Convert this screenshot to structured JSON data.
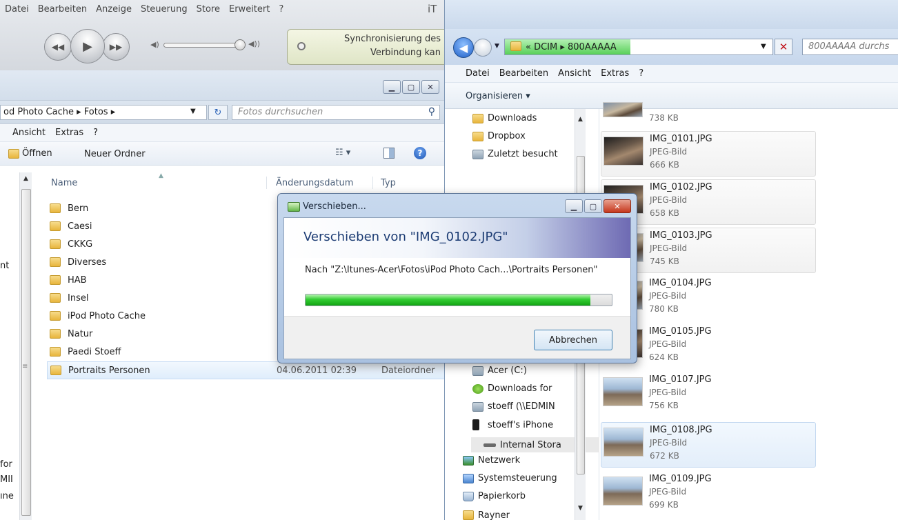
{
  "itunes": {
    "menu": [
      "Datei",
      "Bearbeiten",
      "Anzeige",
      "Steuerung",
      "Store",
      "Erweitert",
      "?"
    ],
    "title_fragment": "iT",
    "sync_line1": "Synchronisierung des",
    "sync_line2": "Verbindung kan"
  },
  "left_window": {
    "breadcrumb": "od Photo Cache ▸ Fotos ▸",
    "search_placeholder": "Fotos durchsuchen",
    "menu": [
      "Ansicht",
      "Extras",
      "?"
    ],
    "toolbar": {
      "open_label": "Öffnen",
      "new_folder_label": "Neuer Ordner"
    },
    "columns": {
      "name": "Name",
      "date": "Änderungsdatum",
      "type": "Typ"
    },
    "nav_fragments": [
      "nt",
      "for",
      "MII",
      "ıne"
    ],
    "folders": [
      {
        "name": "Bern"
      },
      {
        "name": "Caesi"
      },
      {
        "name": "CKKG"
      },
      {
        "name": "Diverses"
      },
      {
        "name": "HAB"
      },
      {
        "name": "Insel"
      },
      {
        "name": "iPod Photo Cache"
      },
      {
        "name": "Natur"
      },
      {
        "name": "Paedi Stoeff"
      },
      {
        "name": "Portraits Personen",
        "date": "04.06.2011 02:39",
        "type": "Dateiordner",
        "selected": true
      }
    ]
  },
  "right_window": {
    "address": "« DCIM ▸ 800AAAAA",
    "address_progress": 0.47,
    "search_placeholder": "800AAAAA durchs",
    "menu": [
      "Datei",
      "Bearbeiten",
      "Ansicht",
      "Extras",
      "?"
    ],
    "organize_label": "Organisieren ▾",
    "nav_items": {
      "downloads": "Downloads",
      "dropbox": "Dropbox",
      "recent": "Zuletzt besucht",
      "acer": "Acer (C:)",
      "downloads_for": "Downloads for",
      "stoeff_share": "stoeff (\\\\EDMIN",
      "stoeff_iphone": "stoeff's iPhone",
      "internal_storage": "Internal Stora",
      "network": "Netzwerk",
      "control_panel": "Systemsteuerung",
      "trash": "Papierkorb",
      "partial": "Rayner"
    },
    "top_tile_size": "738 KB",
    "files": [
      {
        "name": "IMG_0101.JPG",
        "type": "JPEG-Bild",
        "size": "666 KB"
      },
      {
        "name": "IMG_0102.JPG",
        "type": "JPEG-Bild",
        "size": "658 KB"
      },
      {
        "name": "IMG_0103.JPG",
        "type": "JPEG-Bild",
        "size": "745 KB"
      },
      {
        "name": "IMG_0104.JPG",
        "type": "JPEG-Bild",
        "size": "780 KB"
      },
      {
        "name": "IMG_0105.JPG",
        "type": "JPEG-Bild",
        "size": "624 KB"
      },
      {
        "name": "IMG_0107.JPG",
        "type": "JPEG-Bild",
        "size": "756 KB"
      },
      {
        "name": "IMG_0108.JPG",
        "type": "JPEG-Bild",
        "size": "672 KB"
      },
      {
        "name": "IMG_0109.JPG",
        "type": "JPEG-Bild",
        "size": "699 KB"
      }
    ]
  },
  "dialog": {
    "title": "Verschieben...",
    "heading": "Verschieben von \"IMG_0102.JPG\"",
    "destination": "Nach \"Z:\\Itunes-Acer\\Fotos\\iPod Photo Cach...\\Portraits Personen\"",
    "progress": 0.93,
    "cancel_label": "Abbrechen"
  }
}
